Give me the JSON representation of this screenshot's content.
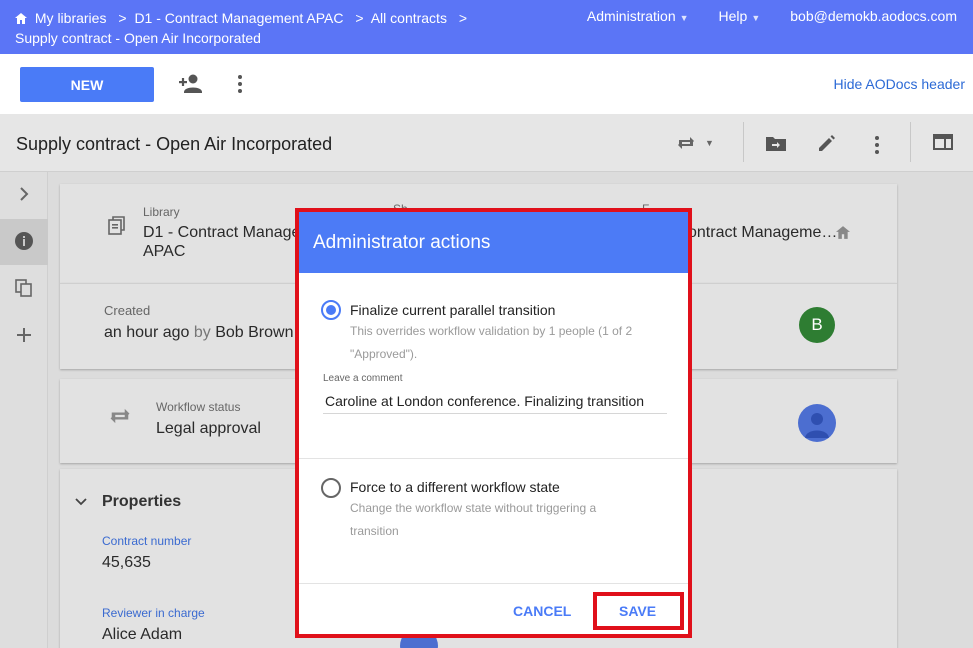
{
  "topbar": {
    "crumbs": [
      "My libraries",
      "D1 - Contract Management APAC",
      "All contracts"
    ],
    "crumb_separator": ">",
    "current_doc": "Supply contract - Open Air Incorporated",
    "admin_menu": "Administration",
    "help_menu": "Help",
    "user_email": "bob@demokb.aodocs.com"
  },
  "actionbar": {
    "new_label": "NEW",
    "hide_header_label": "Hide AODocs header"
  },
  "document": {
    "title": "Supply contract - Open Air Incorporated",
    "library_label": "Library",
    "library_value": "D1 - Contract Manage",
    "library_value_2": "APAC",
    "share_label_partial": "Sh",
    "folder_label_partial": "F",
    "folder_value": "ontract Manageme…",
    "created_label": "Created",
    "created_value": "an hour ago",
    "created_by": "by",
    "created_user": "Bob Brown",
    "avatar_initial": "B",
    "workflow_label": "Workflow status",
    "workflow_value": "Legal approval",
    "properties_title": "Properties",
    "contract_number_label": "Contract number",
    "contract_number_value": "45,635",
    "reviewer_label": "Reviewer in charge",
    "reviewer_value": "Alice Adam"
  },
  "modal": {
    "title": "Administrator actions",
    "option1_label": "Finalize current parallel transition",
    "option1_desc_line1": "This overrides workflow validation by 1 people (1 of 2",
    "option1_desc_line2": "\"Approved\").",
    "comment_label": "Leave a comment",
    "comment_value": "Caroline at London conference. Finalizing transition",
    "option2_label": "Force to a different workflow state",
    "option2_desc_line1": "Change the workflow state without triggering a",
    "option2_desc_line2": "transition",
    "cancel_label": "CANCEL",
    "save_label": "SAVE"
  },
  "colors": {
    "topbar": "#5b75f6",
    "primary": "#4a7bf7",
    "highlight": "#e0101a",
    "avatar_green": "#2e7d32"
  }
}
